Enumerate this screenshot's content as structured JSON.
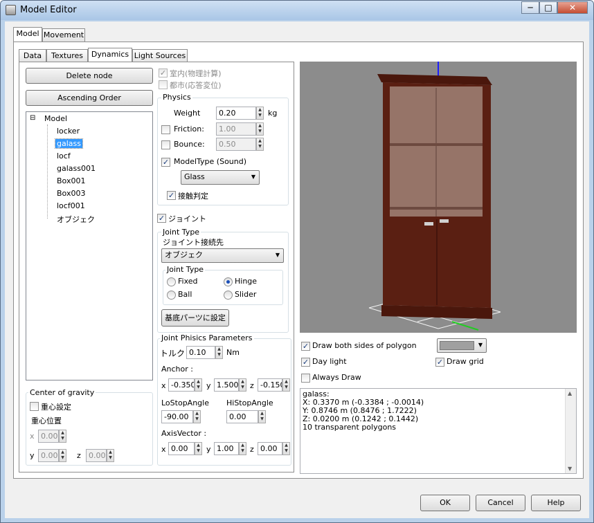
{
  "window": {
    "title": "Model Editor",
    "minimize": "─",
    "maximize": "□",
    "close": "✕"
  },
  "main_tabs": [
    "Model",
    "Movement"
  ],
  "sub_tabs": [
    "Data",
    "Textures",
    "Dynamics",
    "Light Sources"
  ],
  "buttons": {
    "delete_node": "Delete node",
    "ascending_order": "Ascending Order",
    "set_base_parts": "基底パーツに設定",
    "ok": "OK",
    "cancel": "Cancel",
    "help": "Help"
  },
  "tree": {
    "root": "Model",
    "expand_glyph": "⊟",
    "items": [
      "locker",
      "galass",
      "locf",
      "galass001",
      "Box001",
      "Box003",
      "locf001",
      "オブジェク"
    ],
    "selected": "galass"
  },
  "options": {
    "indoor": "室内(物理計算)",
    "city": "都市(応答変位)"
  },
  "physics": {
    "title": "Physics",
    "weight_label": "Weight",
    "weight_value": "0.20",
    "weight_unit": "kg",
    "friction_label": "Friction:",
    "friction_value": "1.00",
    "bounce_label": "Bounce:",
    "bounce_value": "0.50",
    "model_type_label": "ModelType (Sound)",
    "model_type_value": "Glass",
    "contact_label": "接触判定"
  },
  "joint": {
    "checkbox_label": "ジョイント",
    "joint_type_group": "Joint Type",
    "target_label": "ジョイント接続先",
    "target_value": "オブジェク",
    "inner_group": "Joint Type",
    "fixed": "Fixed",
    "hinge": "Hinge",
    "ball": "Ball",
    "slider": "Slider",
    "selected": "Hinge"
  },
  "joint_params": {
    "title": "Joint Phisics Parameters",
    "torque_label": "トルク",
    "torque_value": "0.10",
    "torque_unit": "Nm",
    "anchor_label": "Anchor :",
    "anchor_x": "-0.350",
    "anchor_y": "1.500",
    "anchor_z": "-0.150",
    "lostop_label": "LoStopAngle",
    "lostop_value": "-90.00",
    "histop_label": "HiStopAngle",
    "histop_value": "0.00",
    "axis_label": "AxisVector :",
    "axis_x": "0.00",
    "axis_y": "1.00",
    "axis_z": "0.00",
    "x": "x",
    "y": "y",
    "z": "z"
  },
  "gravity": {
    "title": "Center of gravity",
    "checkbox_label": "重心設定",
    "position_label": "重心位置",
    "x_value": "0.00",
    "y_value": "0.00",
    "z_value": "0.00",
    "x": "x",
    "y": "y",
    "z": "z"
  },
  "view_options": {
    "draw_both_sides": "Draw both sides of polygon",
    "day_light": "Day light",
    "draw_grid": "Draw grid",
    "always_draw": "Always Draw",
    "color_value": ""
  },
  "info_lines": [
    "galass:",
    "X: 0.3370 m (-0.3384 ; -0.0014)",
    "Y: 0.8746 m (0.8476 ; 1.7222)",
    "Z: 0.0200 m (0.1242 ; 0.1442)",
    "10 transparent polygons"
  ],
  "colors": {
    "selection": "#3399ff",
    "cabinet": "#5a1f12",
    "viewport": "#8c8c8c"
  }
}
